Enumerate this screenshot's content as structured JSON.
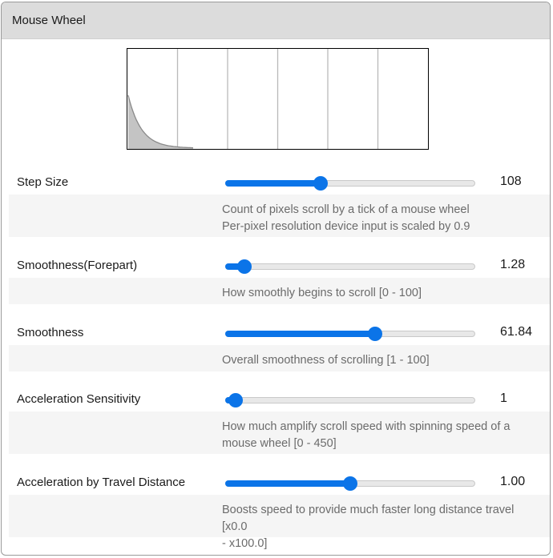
{
  "panel": {
    "title": "Mouse Wheel"
  },
  "accent_color": "#0b74e8",
  "settings": [
    {
      "label": "Step Size",
      "value": "108",
      "slider_fraction": 0.37,
      "description": [
        "Count of pixels scroll by a tick of a mouse wheel",
        "Per-pixel resolution device input is scaled by 0.9"
      ]
    },
    {
      "label": "Smoothness(Forepart)",
      "value": "1.28",
      "slider_fraction": 0.04,
      "description": [
        "How smoothly begins to scroll [0 - 100]"
      ]
    },
    {
      "label": "Smoothness",
      "value": "61.84",
      "slider_fraction": 0.61,
      "description": [
        "Overall smoothness of scrolling [1 - 100]"
      ]
    },
    {
      "label": "Acceleration Sensitivity",
      "value": "1",
      "slider_fraction": 0.0,
      "description": [
        "How much amplify scroll speed with spinning speed of a",
        "mouse wheel [0 - 450]"
      ]
    },
    {
      "label": "Acceleration by Travel Distance",
      "value": "1.00",
      "slider_fraction": 0.5,
      "description": [
        "Boosts speed to provide much faster long distance travel [x0.0",
        "- x100.0]"
      ]
    }
  ]
}
